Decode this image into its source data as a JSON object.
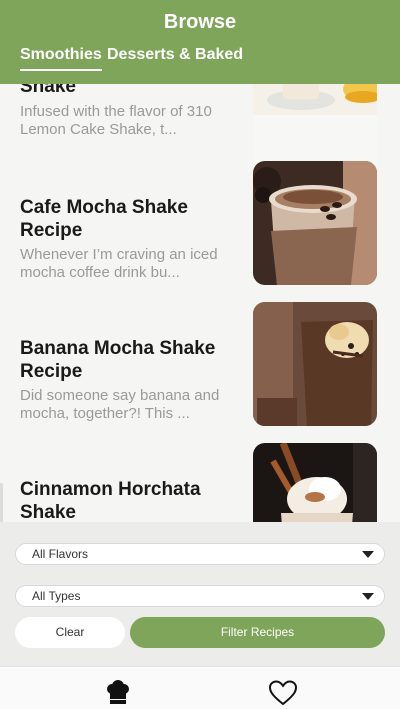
{
  "header": {
    "title": "Browse"
  },
  "tabs": [
    {
      "label": "Smoothies",
      "active": true
    },
    {
      "label": "Desserts & Baked",
      "active": false
    }
  ],
  "recipes": [
    {
      "title": "Shake",
      "description": "Infused with the flavor of 310 Lemon Cake Shake, t..."
    },
    {
      "title": "Cafe Mocha Shake Recipe",
      "description": "Whenever I’m craving an iced mocha coffee drink bu..."
    },
    {
      "title": "Banana Mocha Shake Recipe",
      "description": "Did someone say banana and mocha, together?! This ..."
    },
    {
      "title": "Cinnamon Horchata Shake",
      "description": ""
    }
  ],
  "filters": {
    "flavor": {
      "selected": "All Flavors"
    },
    "type": {
      "selected": "All Types"
    },
    "clear_label": "Clear",
    "filter_label": "Filter Recipes"
  },
  "bottom_nav": [
    {
      "icon": "chef-hat-icon"
    },
    {
      "icon": "heart-icon"
    }
  ],
  "colors": {
    "brand_green": "#7ea55a",
    "text_dark": "#1a1a1a",
    "text_muted": "#9a9a9a"
  }
}
